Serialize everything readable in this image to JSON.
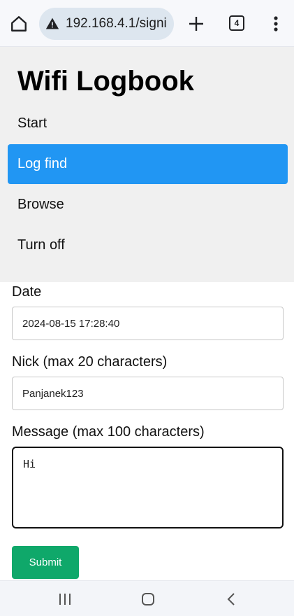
{
  "browser": {
    "url": "192.168.4.1/signi",
    "tab_count": "4",
    "icons": [
      "home-icon",
      "warning-icon",
      "plus-icon",
      "tabs-icon",
      "more-vert-icon"
    ]
  },
  "app": {
    "title": "Wifi Logbook"
  },
  "nav": {
    "items": [
      {
        "label": "Start"
      },
      {
        "label": "Log find"
      },
      {
        "label": "Browse"
      },
      {
        "label": "Turn off"
      }
    ],
    "active_index": 1
  },
  "form": {
    "date_label": "Date",
    "date_value": "2024-08-15 17:28:40",
    "nick_label": "Nick (max 20 characters)",
    "nick_value": "Panjanek123",
    "message_label": "Message (max 100 characters)",
    "message_value": "Hi",
    "submit_label": "Submit"
  },
  "colors": {
    "active_nav": "#2196f3",
    "submit": "#0fa86a",
    "nav_background": "#f0f0f0"
  },
  "system_nav": {
    "icons": [
      "recent-apps-icon",
      "home-circle-icon",
      "back-icon"
    ]
  }
}
